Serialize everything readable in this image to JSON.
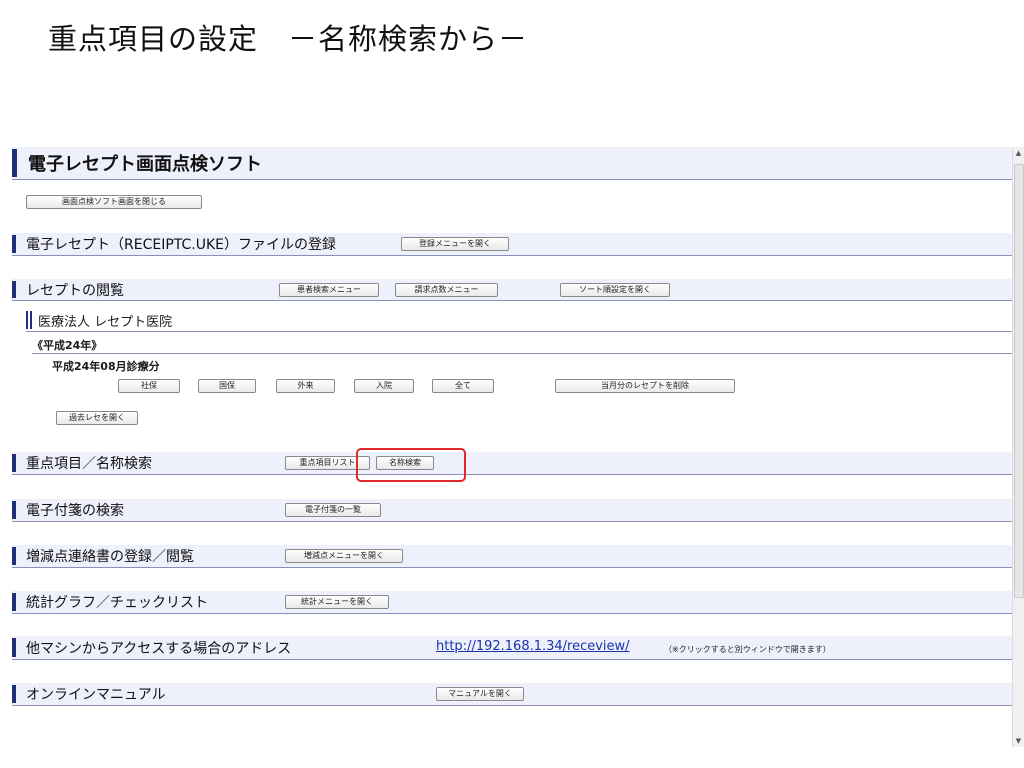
{
  "slide_title": "重点項目の設定　－名称検索から－",
  "app": {
    "title": "電子レセプト画面点検ソフト",
    "close_button": "画面点検ソフト画面を閉じる",
    "register": {
      "label": "電子レセプト（RECEIPTC.UKE）ファイルの登録",
      "open_menu_button": "登録メニューを開く"
    },
    "view": {
      "label": "レセプトの閲覧",
      "patient_search_button": "患者検索メニュー",
      "claim_points_button": "請求点数メニュー",
      "sort_button": "ソート順設定を開く",
      "facility": "医療法人 レセプト医院",
      "year": "《平成24年》",
      "month": "平成24年08月診療分",
      "filters": [
        "社保",
        "国保",
        "外来",
        "入院",
        "全て"
      ],
      "delete_button": "当月分のレセプトを削除",
      "past_button": "過去レセを開く"
    },
    "priority": {
      "label": "重点項目／名称検索",
      "list_button": "重点項目リスト",
      "name_search_button": "名称検索"
    },
    "sticky": {
      "label": "電子付箋の検索",
      "list_button": "電子付箋の一覧"
    },
    "adjust": {
      "label": "増減点連絡書の登録／閲覧",
      "menu_button": "増減点メニューを開く"
    },
    "stats": {
      "label": "統計グラフ／チェックリスト",
      "menu_button": "統計メニューを開く"
    },
    "access": {
      "label": "他マシンからアクセスする場合のアドレス",
      "url": "http://192.168.1.34/receview/",
      "note": "（※クリックすると別ウィンドウで開きます）"
    },
    "manual": {
      "label": "オンラインマニュアル",
      "open_button": "マニュアルを開く"
    }
  },
  "colors": {
    "band_bg": "#eef0fb",
    "mark": "#1f2f7a",
    "highlight": "#e0282d",
    "link": "#1a33aa"
  }
}
